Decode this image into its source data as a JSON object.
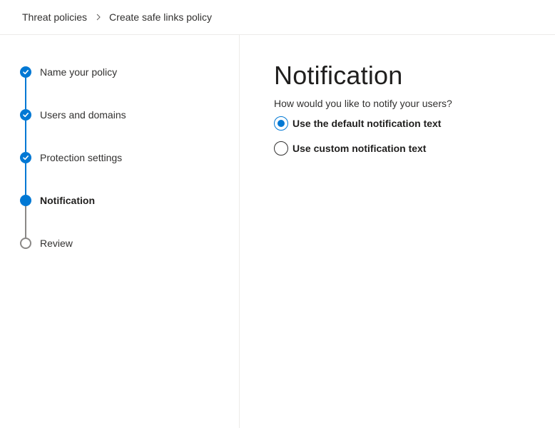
{
  "breadcrumb": {
    "items": [
      "Threat policies",
      "Create safe links policy"
    ]
  },
  "wizard": {
    "steps": [
      {
        "label": "Name your policy",
        "state": "completed"
      },
      {
        "label": "Users and domains",
        "state": "completed"
      },
      {
        "label": "Protection settings",
        "state": "completed"
      },
      {
        "label": "Notification",
        "state": "current"
      },
      {
        "label": "Review",
        "state": "not-started"
      }
    ]
  },
  "main": {
    "title": "Notification",
    "question": "How would you like to notify your users?",
    "options": [
      {
        "label": "Use the default notification text",
        "selected": true
      },
      {
        "label": "Use custom notification text",
        "selected": false
      }
    ]
  },
  "colors": {
    "accent": "#0078d4",
    "inactive": "#8a8886",
    "divider": "#edebe9"
  },
  "icons": {
    "step_completed": "checkmark-icon",
    "breadcrumb_separator": "chevron-right-icon"
  }
}
